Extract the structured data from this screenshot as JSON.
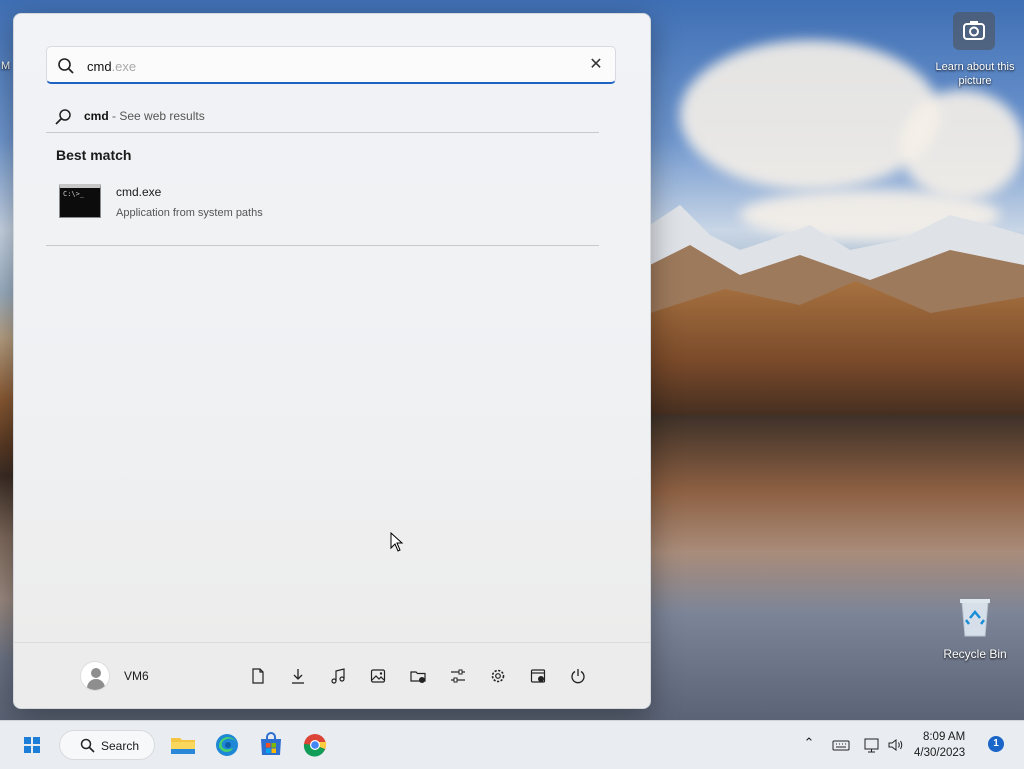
{
  "search": {
    "typed": "cmd",
    "hint": ".exe"
  },
  "web_result": {
    "query": "cmd",
    "suffix": " - See web results"
  },
  "section": {
    "best_match": "Best match"
  },
  "best_result": {
    "name": "cmd.exe",
    "subtitle": "Application from system paths"
  },
  "user": {
    "name": "VM6"
  },
  "footer_icons": [
    "documents-icon",
    "downloads-icon",
    "music-icon",
    "pictures-icon",
    "network-folder-icon",
    "personalization-icon",
    "settings-icon",
    "file-explorer-icon",
    "power-icon"
  ],
  "taskbar": {
    "search_label": "Search",
    "time": "8:09 AM",
    "date": "4/30/2023",
    "notifications": "1"
  },
  "desktop": {
    "camera_label": "Learn about this picture",
    "recycle_label": "Recycle Bin",
    "edge_fragment": "M"
  },
  "colors": {
    "accent": "#1f63c2",
    "taskbar_bg": "#e9ecf1",
    "menu_bg": "#eef1f4"
  }
}
